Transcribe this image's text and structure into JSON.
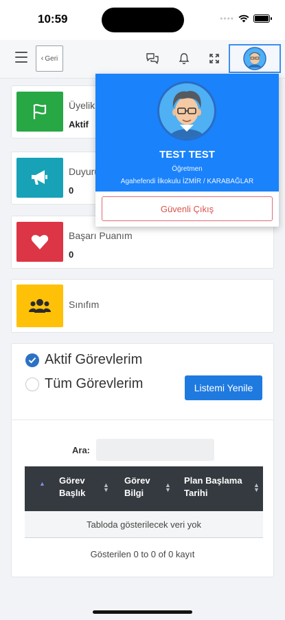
{
  "status_bar": {
    "time": "10:59"
  },
  "navbar": {
    "back_label": "Geri"
  },
  "cards": [
    {
      "label": "Üyelik",
      "value": "Aktif",
      "color": "#28a745",
      "icon": "flag-icon"
    },
    {
      "label": "Duyuru",
      "value": "0",
      "color": "#17a2b8",
      "icon": "megaphone-icon"
    },
    {
      "label": "Başarı Puanım",
      "value": "0",
      "color": "#dc3545",
      "icon": "heart-icon"
    },
    {
      "label": "Sınıfım",
      "value": "",
      "color": "#ffc107",
      "icon": "users-icon"
    }
  ],
  "tasks": {
    "option_active": "Aktif Görevlerim",
    "option_all": "Tüm Görevlerim",
    "refresh_label": "Listemi Yenile",
    "search_label": "Ara:",
    "columns": [
      "Görev Başlık",
      "Görev Bilgi",
      "Plan Başlama Tarihi"
    ],
    "empty_text": "Tabloda gösterilecek veri yok",
    "info_text": "Gösterilen 0 to 0 of 0 kayıt"
  },
  "profile": {
    "name": "TEST TEST",
    "role": "Öğretmen",
    "school": "Agahefendi İlkokulu İZMİR / KARABAĞLAR",
    "logout_label": "Güvenli Çıkış"
  },
  "colors": {
    "primary": "#1a82fb",
    "button": "#1f7ae0",
    "danger": "#d9534f",
    "dark_header": "#343a40"
  }
}
